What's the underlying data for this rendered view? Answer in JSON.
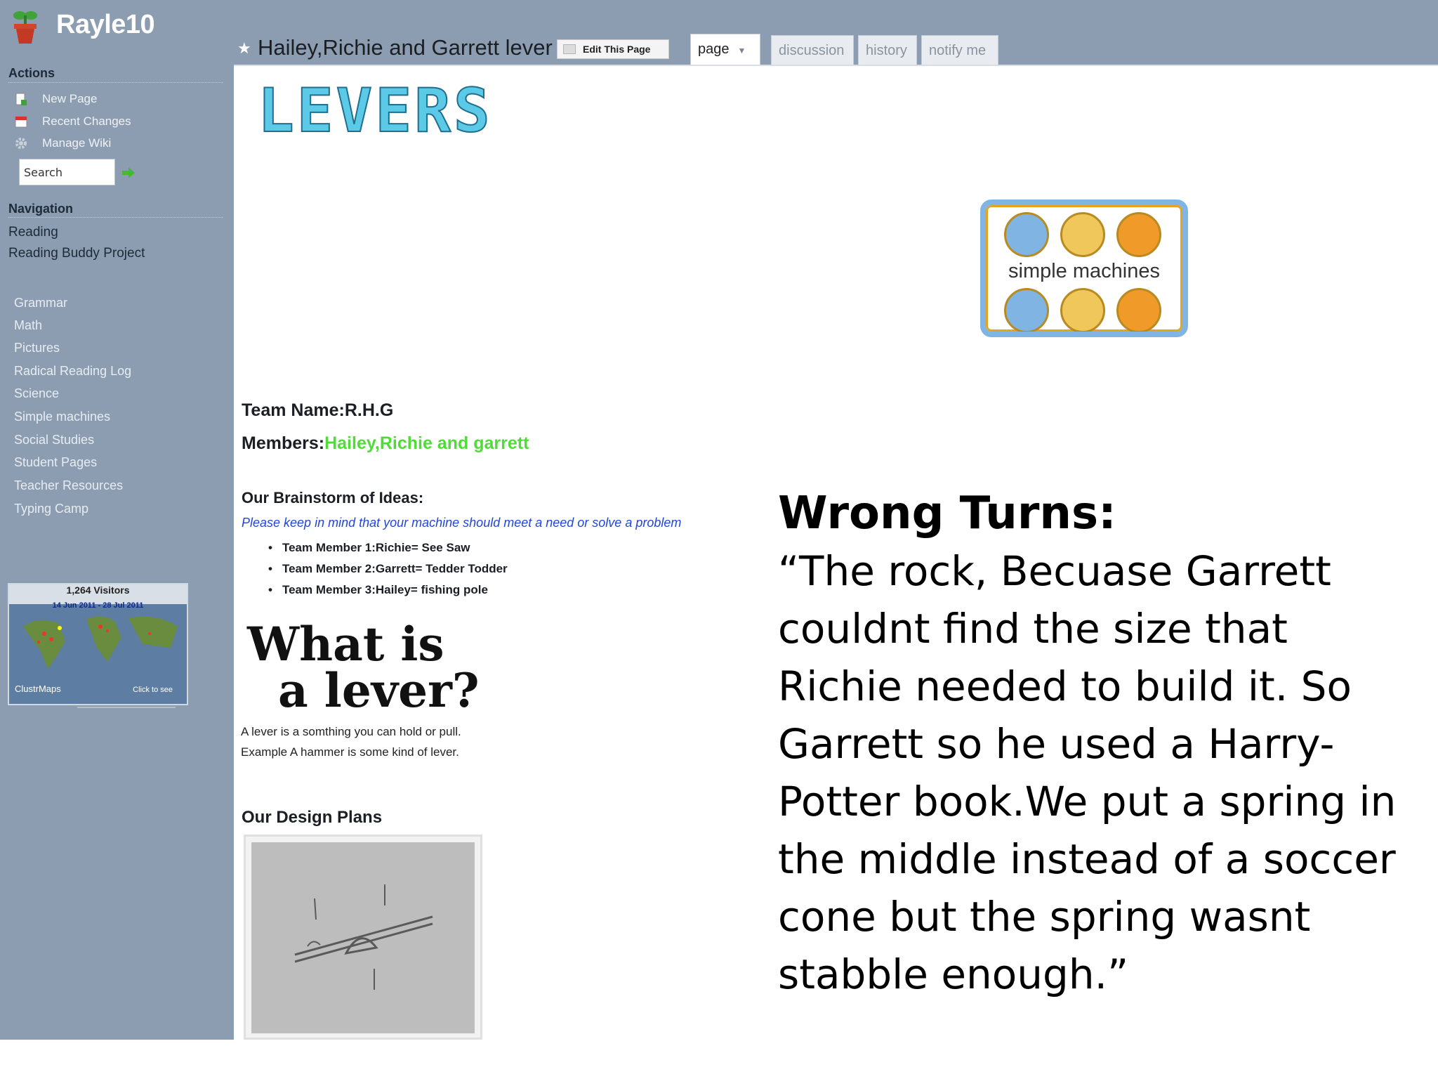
{
  "site": {
    "title": "Rayle10"
  },
  "sidebar": {
    "actions_heading": "Actions",
    "actions": [
      {
        "label": "New Page",
        "icon": "new-page-icon"
      },
      {
        "label": "Recent Changes",
        "icon": "calendar-icon"
      },
      {
        "label": "Manage Wiki",
        "icon": "gear-icon"
      }
    ],
    "search_value": "Search",
    "navigation_heading": "Navigation",
    "nav_primary": [
      "Reading",
      "Reading Buddy Project"
    ],
    "nav_secondary": [
      "Grammar",
      "Math",
      "Pictures",
      "Radical Reading Log",
      "Science",
      "Simple machines",
      "Social Studies",
      "Student Pages",
      "Teacher Resources",
      "Typing Camp"
    ],
    "map": {
      "visitors": "1,264 Visitors",
      "dates": "14 Jun 2011 - 28 Jul 2011",
      "brand": "ClustrMaps",
      "click": "Click to see"
    }
  },
  "header": {
    "page_title": "Hailey,Richie and Garrett lever",
    "edit_button": "Edit This Page",
    "tabs": [
      {
        "label": "page",
        "active": true
      },
      {
        "label": "discussion",
        "active": false
      },
      {
        "label": "history",
        "active": false
      },
      {
        "label": "notify me",
        "active": false
      }
    ]
  },
  "content": {
    "levers_banner": "LEVERS",
    "poster_label": "simple machines",
    "team_name": "Team Name:R.H.G",
    "members_label": "Members:",
    "members_value": "Hailey,Richie and garrett",
    "brainstorm_heading": "Our Brainstorm of Ideas:",
    "brainstorm_note": "Please keep in mind that your machine should meet a need or solve a problem",
    "brainstorm_items": [
      "Team Member 1:Richie= See Saw",
      "Team Member 2:Garrett= Tedder Todder",
      "Team Member 3:Hailey= fishing pole"
    ],
    "what_is_lever_line1": "What is",
    "what_is_lever_line2": "a lever?",
    "definition_1": "A lever is a somthing you can hold or pull.",
    "definition_2": "Example A hammer is some kind of lever.",
    "design_heading": "Our Design Plans"
  },
  "overlay": {
    "heading": "Wrong Turns:",
    "quote": "“The rock, Becuase Garrett couldnt find the size that Richie needed to build it. So Garrett so he used a Harry-Potter book.We put a spring in the middle instead of a soccer cone but the spring wasnt stabble enough.”"
  },
  "colors": {
    "frame": "#8d9db1",
    "members_green": "#4fdc37",
    "note_blue": "#2146d8",
    "levers_cyan": "#5cc9e6"
  }
}
